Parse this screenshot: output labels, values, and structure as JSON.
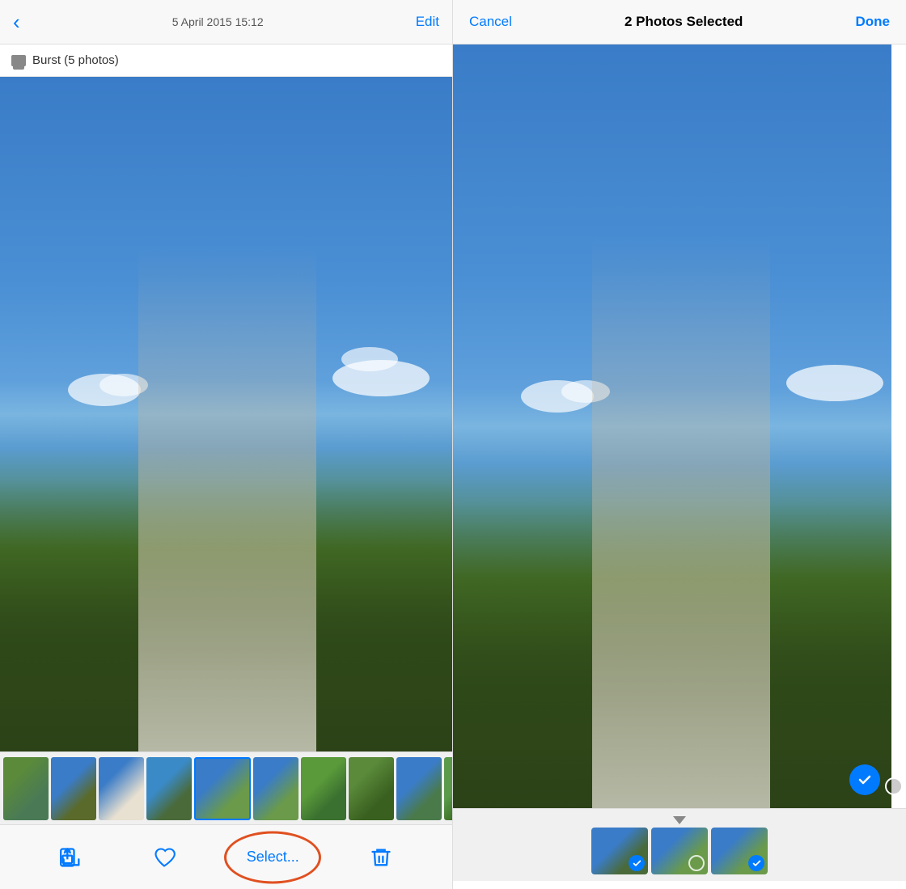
{
  "left": {
    "header": {
      "back_icon": "chevron-left",
      "title": "5 April 2015  15:12",
      "edit_label": "Edit"
    },
    "burst_label": "Burst (5 photos)",
    "toolbar": {
      "share_label": "Share",
      "favorite_label": "Favorite",
      "select_label": "Select...",
      "delete_label": "Delete"
    }
  },
  "right": {
    "header": {
      "cancel_label": "Cancel",
      "title": "2 Photos Selected",
      "done_label": "Done"
    }
  }
}
